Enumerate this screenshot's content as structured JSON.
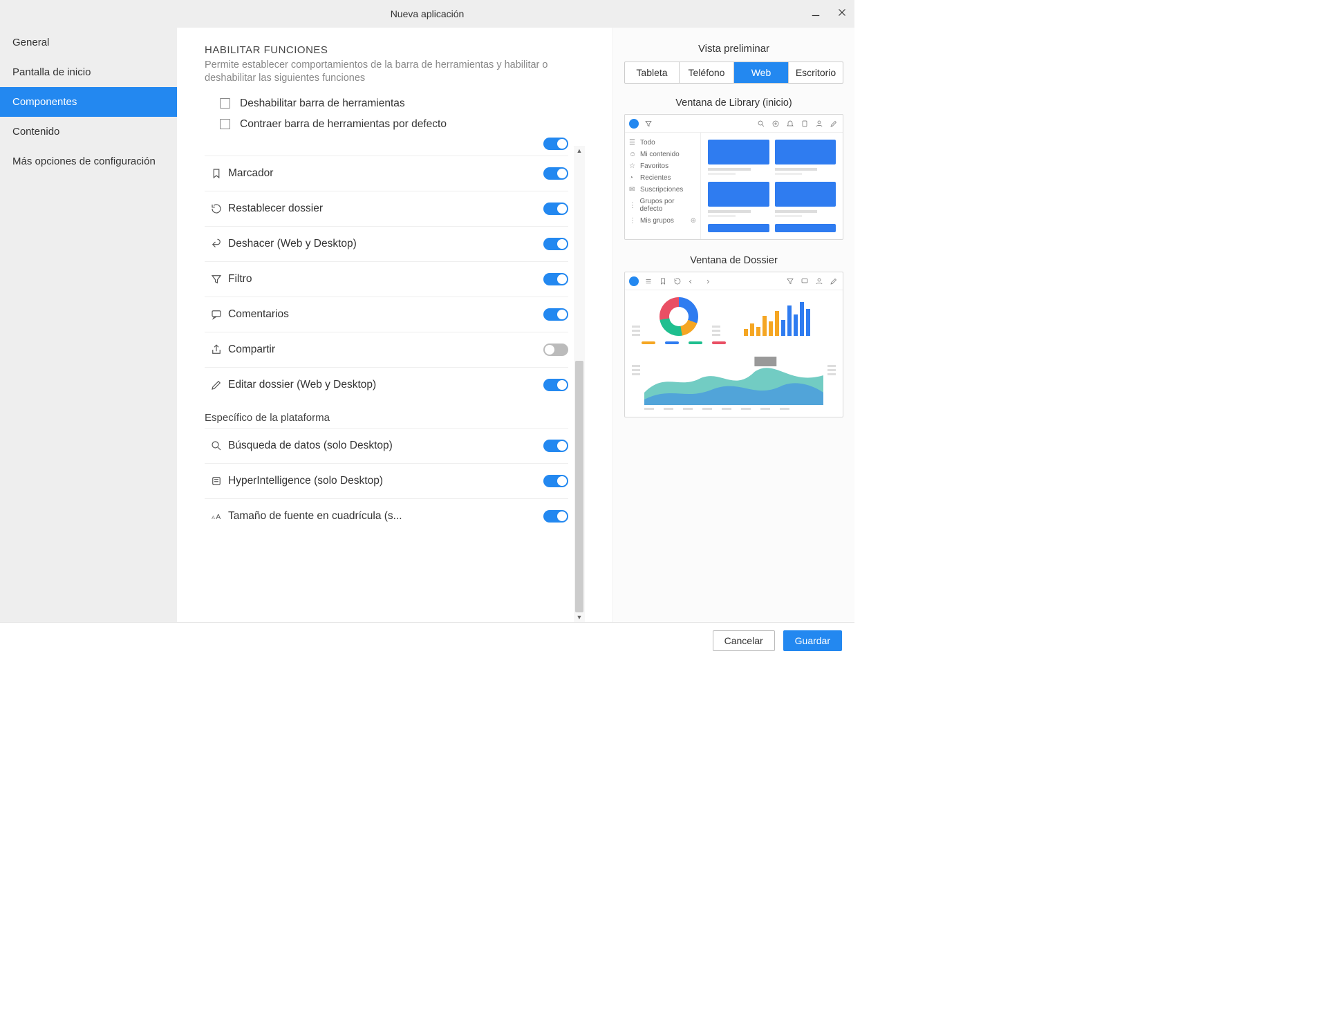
{
  "window": {
    "title": "Nueva aplicación"
  },
  "sidebar": {
    "items": [
      {
        "label": "General"
      },
      {
        "label": "Pantalla de inicio"
      },
      {
        "label": "Componentes"
      },
      {
        "label": "Contenido"
      },
      {
        "label": "Más opciones de configuración"
      }
    ]
  },
  "main": {
    "section_title": "HABILITAR FUNCIONES",
    "section_desc": "Permite establecer comportamientos de la barra de herramientas y habilitar o deshabilitar las siguientes funciones",
    "checkboxes": [
      {
        "label": "Deshabilitar barra de herramientas"
      },
      {
        "label": "Contraer barra de herramientas por defecto"
      }
    ],
    "toggles": [
      {
        "label": "Marcador",
        "on": true,
        "icon": "bookmark"
      },
      {
        "label": "Restablecer dossier",
        "on": true,
        "icon": "history"
      },
      {
        "label": "Deshacer (Web y Desktop)",
        "on": true,
        "icon": "undo"
      },
      {
        "label": "Filtro",
        "on": true,
        "icon": "filter"
      },
      {
        "label": "Comentarios",
        "on": true,
        "icon": "comment"
      },
      {
        "label": "Compartir",
        "on": false,
        "icon": "share"
      },
      {
        "label": "Editar dossier (Web y Desktop)",
        "on": true,
        "icon": "edit"
      }
    ],
    "platform_title": "Específico de la plataforma",
    "platform_toggles": [
      {
        "label": "Búsqueda de datos (solo Desktop)",
        "on": true,
        "icon": "search"
      },
      {
        "label": "HyperIntelligence (solo Desktop)",
        "on": true,
        "icon": "card"
      },
      {
        "label": "Tamaño de fuente en cuadrícula (s...",
        "on": true,
        "icon": "fontsize"
      }
    ]
  },
  "preview": {
    "title": "Vista preliminar",
    "tabs": [
      {
        "label": "Tableta"
      },
      {
        "label": "Teléfono"
      },
      {
        "label": "Web"
      },
      {
        "label": "Escritorio"
      }
    ],
    "library_title": "Ventana de Library (inicio)",
    "library_side": [
      {
        "label": "Todo"
      },
      {
        "label": "Mi contenido"
      },
      {
        "label": "Favoritos"
      },
      {
        "label": "Recientes"
      },
      {
        "label": "Suscripciones"
      },
      {
        "label": "Grupos por defecto"
      },
      {
        "label": "Mis grupos"
      }
    ],
    "dossier_title": "Ventana de Dossier"
  },
  "footer": {
    "cancel": "Cancelar",
    "save": "Guardar"
  }
}
